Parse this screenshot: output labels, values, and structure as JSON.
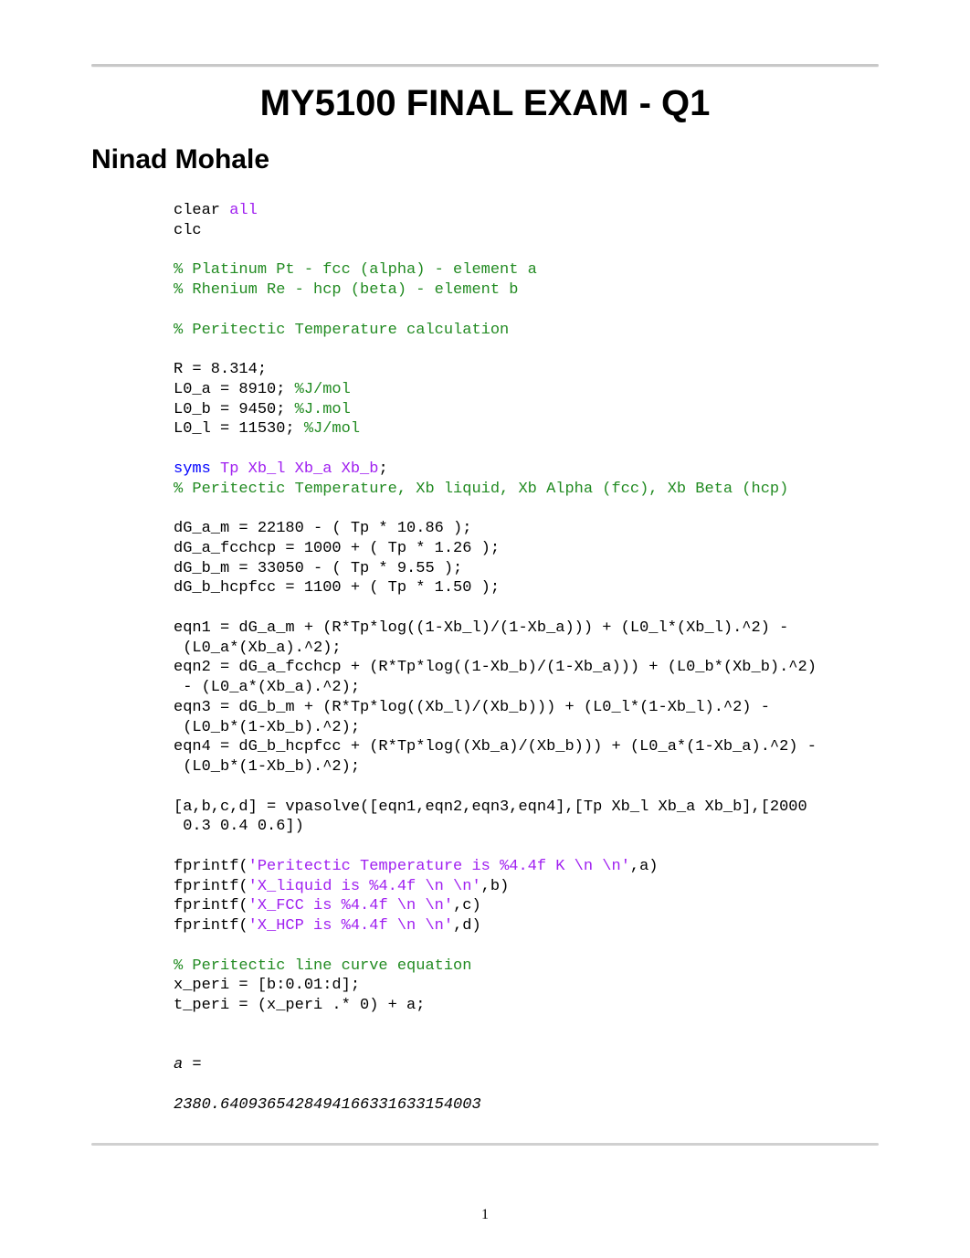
{
  "header": {
    "title": "MY5100 FINAL EXAM - Q1",
    "author": "Ninad Mohale"
  },
  "code": {
    "l1a": "clear ",
    "l1b": "all",
    "l2": "clc",
    "l3": "",
    "l4": "% Platinum Pt - fcc (alpha) - element a",
    "l5": "% Rhenium Re - hcp (beta) - element b",
    "l6": "",
    "l7": "% Peritectic Temperature calculation",
    "l8": "",
    "l9": "R = 8.314;",
    "l10a": "L0_a = 8910; ",
    "l10b": "%J/mol",
    "l11a": "L0_b = 9450; ",
    "l11b": "%J.mol",
    "l12a": "L0_l = 11530; ",
    "l12b": "%J/mol",
    "l13": "",
    "l14a": "syms ",
    "l14b": "Tp Xb_l Xb_a Xb_b",
    "l14c": ";",
    "l15": "% Peritectic Temperature, Xb liquid, Xb Alpha (fcc), Xb Beta (hcp)",
    "l16": "",
    "l17": "dG_a_m = 22180 - ( Tp * 10.86 );",
    "l18": "dG_a_fcchcp = 1000 + ( Tp * 1.26 );",
    "l19": "dG_b_m = 33050 - ( Tp * 9.55 );",
    "l20": "dG_b_hcpfcc = 1100 + ( Tp * 1.50 );",
    "l21": "",
    "l22": "eqn1 = dG_a_m + (R*Tp*log((1-Xb_l)/(1-Xb_a))) + (L0_l*(Xb_l).^2) -\n (L0_a*(Xb_a).^2);",
    "l23": "eqn2 = dG_a_fcchcp + (R*Tp*log((1-Xb_b)/(1-Xb_a))) + (L0_b*(Xb_b).^2)\n - (L0_a*(Xb_a).^2);",
    "l24": "eqn3 = dG_b_m + (R*Tp*log((Xb_l)/(Xb_b))) + (L0_l*(1-Xb_l).^2) -\n (L0_b*(1-Xb_b).^2);",
    "l25": "eqn4 = dG_b_hcpfcc + (R*Tp*log((Xb_a)/(Xb_b))) + (L0_a*(1-Xb_a).^2) -\n (L0_b*(1-Xb_b).^2);",
    "l26": "",
    "l27": "[a,b,c,d] = vpasolve([eqn1,eqn2,eqn3,eqn4],[Tp Xb_l Xb_a Xb_b],[2000\n 0.3 0.4 0.6])",
    "l28": "",
    "l29a": "fprintf(",
    "l29b": "'Peritectic Temperature is %4.4f K \\n \\n'",
    "l29c": ",a)",
    "l30a": "fprintf(",
    "l30b": "'X_liquid is %4.4f \\n \\n'",
    "l30c": ",b)",
    "l31a": "fprintf(",
    "l31b": "'X_FCC is %4.4f \\n \\n'",
    "l31c": ",c)",
    "l32a": "fprintf(",
    "l32b": "'X_HCP is %4.4f \\n \\n'",
    "l32c": ",d)",
    "l33": "",
    "l34": "% Peritectic line curve equation",
    "l35": "x_peri = [b:0.01:d];",
    "l36": "t_peri = (x_peri .* 0) + a;",
    "l37": "",
    "l38": "",
    "o1": "a =",
    "o2": "",
    "o3": "2380.6409365428494166331633154003"
  },
  "footer": {
    "page_number": "1"
  }
}
